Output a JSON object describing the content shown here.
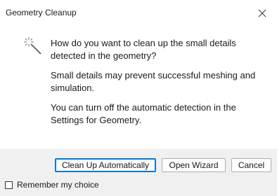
{
  "window": {
    "title": "Geometry Cleanup",
    "close_glyph": "✕"
  },
  "icon": {
    "name": "cleanup-wand-icon"
  },
  "message": {
    "question": "How do you want to clean up the small details detected in the geometry?",
    "detail": "Small details may prevent successful meshing and simulation.",
    "hint": "You can turn off the automatic detection in the Settings for Geometry."
  },
  "buttons": {
    "clean_up_automatically": "Clean Up Automatically",
    "open_wizard": "Open Wizard",
    "cancel": "Cancel"
  },
  "remember_choice": {
    "label": "Remember my choice",
    "checked": false
  },
  "colors": {
    "footer_bg": "#f0f0f0",
    "accent": "#0078d4"
  }
}
